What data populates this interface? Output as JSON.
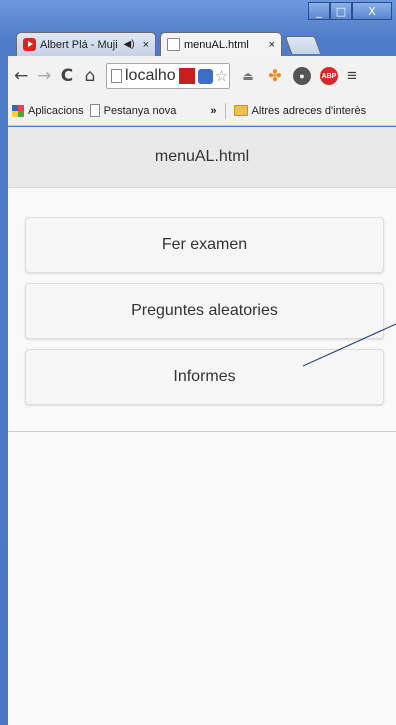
{
  "window": {
    "minimize": "_",
    "maximize": "□",
    "close": "X"
  },
  "tabs": [
    {
      "title": "Albert Plá - Muji",
      "audio_icon": "speaker-icon",
      "close": "×",
      "favicon": "youtube-icon"
    },
    {
      "title": "menuAL.html",
      "close": "×",
      "favicon": "page-icon"
    }
  ],
  "toolbar": {
    "back": "←",
    "forward": "→",
    "reload": "C",
    "home": "⌂",
    "address": "localho",
    "abp_label": "ABP",
    "menu": "≡"
  },
  "bookmarks": {
    "apps": "Aplicacions",
    "items": [
      "Pestanya nova"
    ],
    "overflow": "»",
    "other": "Altres adreces d'interès"
  },
  "page": {
    "title": "menuAL.html",
    "buttons": [
      "Fer examen",
      "Preguntes aleatories",
      "Informes"
    ]
  }
}
